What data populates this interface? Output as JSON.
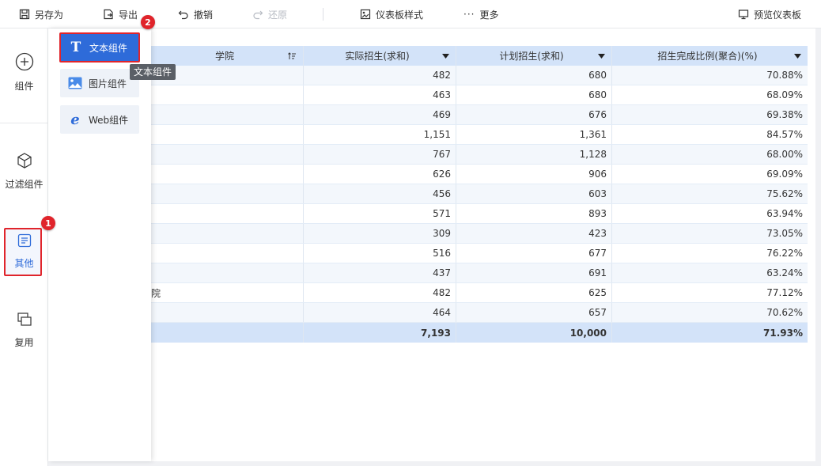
{
  "toolbar": {
    "save_as": "另存为",
    "export": "导出",
    "undo": "撤销",
    "redo": "还原",
    "dashboard_style": "仪表板样式",
    "more": "更多",
    "preview": "预览仪表板"
  },
  "sidebar": {
    "items": [
      {
        "label": "组件",
        "icon": "plus-circle-icon"
      },
      {
        "label": "过滤组件",
        "icon": "cube-icon"
      },
      {
        "label": "其他",
        "icon": "document-icon"
      },
      {
        "label": "复用",
        "icon": "copy-icon"
      }
    ]
  },
  "panel": {
    "items": [
      {
        "label": "文本组件",
        "icon": "text-icon"
      },
      {
        "label": "图片组件",
        "icon": "image-icon"
      },
      {
        "label": "Web组件",
        "icon": "web-icon"
      }
    ],
    "tooltip": "文本组件"
  },
  "badges": {
    "one": "1",
    "two": "2"
  },
  "table": {
    "headers": [
      "学院",
      "实际招生(求和)",
      "计划招生(求和)",
      "招生完成比例(聚合)(%)"
    ],
    "rows": [
      [
        "",
        "482",
        "680",
        "70.88%"
      ],
      [
        "",
        "463",
        "680",
        "68.09%"
      ],
      [
        "",
        "469",
        "676",
        "69.38%"
      ],
      [
        "",
        "1,151",
        "1,361",
        "84.57%"
      ],
      [
        "",
        "767",
        "1,128",
        "68.00%"
      ],
      [
        "",
        "626",
        "906",
        "69.09%"
      ],
      [
        "",
        "456",
        "603",
        "75.62%"
      ],
      [
        "",
        "571",
        "893",
        "63.94%"
      ],
      [
        "",
        "309",
        "423",
        "73.05%"
      ],
      [
        "",
        "516",
        "677",
        "76.22%"
      ],
      [
        "",
        "437",
        "691",
        "63.24%"
      ],
      [
        "院",
        "482",
        "625",
        "77.12%"
      ],
      [
        "",
        "464",
        "657",
        "70.62%"
      ]
    ],
    "total": [
      "",
      "7,193",
      "10,000",
      "71.93%"
    ]
  },
  "colors": {
    "accent": "#2e6bd9",
    "highlight": "#e0242b",
    "header_bg": "#d3e3f9"
  }
}
